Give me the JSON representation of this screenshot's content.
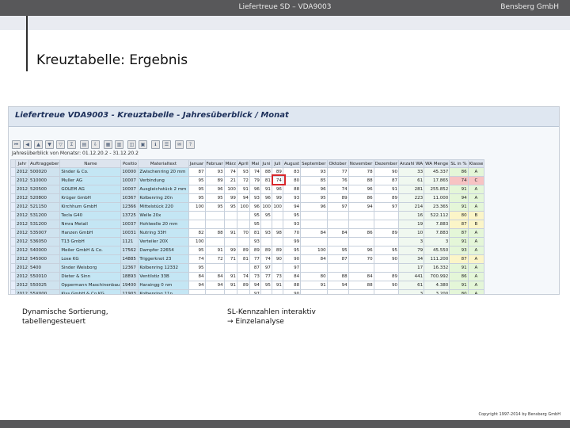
{
  "header": {
    "center_title": "Liefertreue SD – VDA9003",
    "company": "Bensberg GmbH"
  },
  "slide_title": "Kreuztabelle: Ergebnis",
  "sap": {
    "window_title": "Liefertreue VDA9003 - Kreuztabelle - Jahresüberblick / Monat",
    "info_line": "Jahresüberblick von Monatsr: 01.12.20.2 - 31.12.20.2",
    "columns": [
      "Jahr",
      "Auftraggeber",
      "Name",
      "Positio",
      "Materialtext",
      "Januar",
      "Februar",
      "März",
      "April",
      "Mai",
      "Juni",
      "Juli",
      "August",
      "September",
      "Oktober",
      "November",
      "Dezember",
      "Anzahl WA",
      "WA Menge",
      "SL in %",
      "Klasse"
    ],
    "rows": [
      [
        "2012",
        "500020",
        "Sinder & Co.",
        "10000",
        "Zwischenring 20 mm",
        "87",
        "93",
        "74",
        "93",
        "74",
        "88",
        "89",
        "83",
        "93",
        "77",
        "78",
        "90",
        "33",
        "45.337",
        "86",
        "A"
      ],
      [
        "2012",
        "510000",
        "Muller AG",
        "10007",
        "Verbindung",
        "95",
        "89",
        "21",
        "72",
        "79",
        "81",
        "74",
        "80",
        "85",
        "76",
        "88",
        "87",
        "61",
        "17.865",
        "74",
        "C"
      ],
      [
        "2012",
        "520500",
        "GOLEM AG",
        "10007",
        "Ausgleichstück 2 mm",
        "95",
        "96",
        "100",
        "91",
        "96",
        "91",
        "96",
        "88",
        "96",
        "74",
        "96",
        "91",
        "281",
        "255.852",
        "91",
        "A"
      ],
      [
        "2012",
        "520800",
        "Krüger GmbH",
        "10367",
        "Kolbenring 20n",
        "95",
        "95",
        "99",
        "94",
        "93",
        "96",
        "99",
        "93",
        "95",
        "89",
        "86",
        "89",
        "223",
        "11.000",
        "94",
        "A"
      ],
      [
        "2012",
        "521150",
        "Kirchhum GmbH",
        "12366",
        "Mittelstück 220",
        "100",
        "95",
        "95",
        "100",
        "96",
        "100",
        "100",
        "94",
        "96",
        "97",
        "94",
        "97",
        "214",
        "23.365",
        "91",
        "A"
      ],
      [
        "2012",
        "531200",
        "Tecla G40",
        "13725",
        "Welle 20x",
        "",
        "",
        "",
        "",
        "95",
        "95",
        "",
        "95",
        "",
        "",
        "",
        "",
        "16",
        "522.112",
        "80",
        "B"
      ],
      [
        "2012",
        "531200",
        "Nmra Metall",
        "10037",
        "Hohlwelle 20 mm",
        "",
        "",
        "",
        "",
        "95",
        "",
        "",
        "93",
        "",
        "",
        "",
        "",
        "19",
        "7.883",
        "87",
        "B"
      ],
      [
        "2012",
        "535007",
        "Hanzen GmbH",
        "10031",
        "Nutring 33H",
        "82",
        "88",
        "91",
        "70",
        "81",
        "93",
        "98",
        "70",
        "84",
        "84",
        "86",
        "89",
        "10",
        "7.883",
        "87",
        "A"
      ],
      [
        "2012",
        "536050",
        "T13 GmbH",
        "1121",
        "Verteiler 20X",
        "100",
        "",
        "",
        "",
        "93",
        "",
        "",
        "99",
        "",
        "",
        "",
        "",
        "3",
        "3",
        "91",
        "A"
      ],
      [
        "2012",
        "540000",
        "Meiler GmbH & Co.",
        "17562",
        "Dampfer 22654",
        "95",
        "91",
        "99",
        "89",
        "89",
        "89",
        "89",
        "95",
        "100",
        "95",
        "96",
        "95",
        "79",
        "45.550",
        "93",
        "A"
      ],
      [
        "2012",
        "545000",
        "Lose KG",
        "14885",
        "Triggerknot 23",
        "74",
        "72",
        "71",
        "81",
        "77",
        "74",
        "90",
        "90",
        "84",
        "87",
        "70",
        "90",
        "34",
        "111.200",
        "87",
        "A"
      ],
      [
        "2012",
        "5400",
        "Sinder Weisborg",
        "12367",
        "Kolbenring 12332",
        "95",
        "",
        "",
        "",
        "87",
        "97",
        "",
        "97",
        "",
        "",
        "",
        "",
        "17",
        "16.332",
        "91",
        "A"
      ],
      [
        "2012",
        "550010",
        "Dieter & Sinn",
        "18893",
        "Ventilstiz 33B",
        "84",
        "84",
        "91",
        "74",
        "73",
        "77",
        "73",
        "84",
        "80",
        "88",
        "84",
        "89",
        "441",
        "700.992",
        "86",
        "A"
      ],
      [
        "2012",
        "550025",
        "Oppermann Maschinenbau",
        "19400",
        "Haraingg 0 nm",
        "94",
        "94",
        "91",
        "89",
        "94",
        "95",
        "91",
        "88",
        "91",
        "94",
        "88",
        "90",
        "61",
        "4.380",
        "91",
        "A"
      ],
      [
        "2012",
        "55X000",
        "Kiss GmbH & Co.KG",
        "11903",
        "Kolbenring 11n",
        "",
        "",
        "",
        "",
        "97",
        "",
        "",
        "90",
        "",
        "",
        "",
        "",
        "3",
        "3.200",
        "80",
        "A"
      ],
      [
        "2012",
        "5629",
        "Schütt AG",
        "1222",
        "Ausgleichsstück 2mm",
        "",
        "",
        "",
        "",
        "",
        "",
        "",
        "",
        "",
        "",
        "",
        "",
        "2",
        "4.2",
        "100",
        "A"
      ]
    ],
    "row_status": [
      "green",
      "red",
      "green",
      "green",
      "green",
      "yellow",
      "yellow",
      "green",
      "green",
      "green",
      "yellow",
      "green",
      "green",
      "green",
      "green",
      "green"
    ]
  },
  "notes": {
    "left_line1": "Dynamische Sortierung,",
    "left_line2": "tabellengesteuert",
    "right_line1": "SL-Kennzahlen interaktiv",
    "right_line2": "→ Einzelanalyse"
  },
  "copyright": "Copyright 1997-2014 by Bensberg GmbH",
  "colors": {
    "topbar": "#58585a",
    "highlight_box": "#d8272c",
    "name_column": "#c4e6f4",
    "good": "#e4f6d8",
    "warn": "#fbf5c8",
    "bad": "#f7c3c3"
  }
}
